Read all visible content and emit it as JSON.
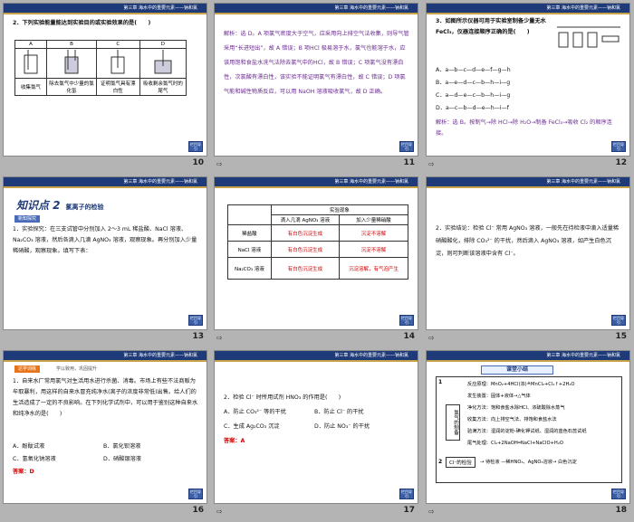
{
  "header_text": "第三章 海水中的重要元素——钠和氯",
  "nav_label": "栏目导引",
  "foot_icon": "⇨",
  "slides": [
    {
      "num": "10",
      "q": "2．下列实验能量能达到实验目的或实验效果的是(　　)",
      "cols": [
        "A",
        "B",
        "C",
        "D"
      ],
      "labels": [
        "收集氯气",
        "除去氯气中少量的氯化氢",
        "证明氯气具有漂白性",
        "吸收剩余氯气时的尾气"
      ]
    },
    {
      "num": "11",
      "text": "解析：选 D。A 项氯气密度大于空气，应采用向上排空气法收集，则导气管采用“长进短出”，故 A 错误；B 项HCl 极易溶于水，氯气也能溶于水，应该用饱和食盐水洗气法除去氯气中的HCl，故 B 错误；C 项氯气没有漂白性，次氯酸有漂白性，该实验不能证明氯气有漂白性，故 C 错误；D 项氯气能和碱性物质反应，可以用 NaOH 溶液吸收氯气，故 D 正确。"
    },
    {
      "num": "12",
      "q": "3．如图所示仪器可用于实验室制备少量无水 FeCl₃，仪器连接顺序正确的是(　　)",
      "opts": [
        "A．a—b—c—d—e—f—g—h",
        "B．a—e—d—c—b—h—i—g",
        "C．a—d—e—c—b—h—i—g",
        "D．a—c—b—d—e—h—i—f"
      ],
      "ans": "解析：选 B。按制气→除 HCl→除 H₂O→制备 FeCl₃→吸收 Cl₂ 的顺序连接。"
    },
    {
      "num": "13",
      "kp_title": "知识点 2",
      "kp_sub": "氯离子的检验",
      "tag": "新知探究",
      "text": "1．实验探究：在三支试管中分别加入 2～3 mL 稀盐酸、NaCl 溶液、Na₂CO₃ 溶液，然后各滴入几滴 AgNO₃ 溶液，观察现象。再分别加入少量稀硝酸，观察现象。填写下表："
    },
    {
      "num": "14",
      "th": [
        "",
        "实验现象"
      ],
      "sub": [
        "滴入几滴 AgNO₃ 溶液",
        "加入少量稀硝酸"
      ],
      "rows": [
        [
          "稀盐酸",
          "有白色沉淀生成",
          "沉淀不溶解"
        ],
        [
          "NaCl 溶液",
          "有白色沉淀生成",
          "沉淀不溶解"
        ],
        [
          "Na₂CO₃ 溶液",
          "有白色沉淀生成",
          "沉淀溶解，有气泡产生"
        ]
      ]
    },
    {
      "num": "15",
      "text": "2．实验结论：检验 Cl⁻ 常用 AgNO₃ 溶液，一般先在待检液中滴入适量稀硝酸酸化，排除 CO₃²⁻ 的干扰，然后滴入 AgNO₃ 溶液，如产生白色沉淀，则可判断该溶液中含有 Cl⁻。"
    },
    {
      "num": "16",
      "tag": "达学训练",
      "tag2": "学以致用，巩固提升",
      "q": "1．自来水厂常用氯气对生活用水进行杀菌、消毒。市场上有些不法商贩为牟取暴利，用这样的自来水冒充纯净水(离子的浓度非常低)出售。给人们的生活造成了一定的不良影响。在下列化学试剂中，可以用于鉴别这种自来水和纯净水的是(　　)",
      "opts": [
        "A．酚酞试液",
        "B．氯化钡溶液",
        "C．氢氧化钠溶液",
        "D．硝酸银溶液"
      ],
      "ans": "答案：D"
    },
    {
      "num": "17",
      "q": "2．检验 Cl⁻ 时所用试剂 HNO₃ 的作用是(　　)",
      "opts": [
        "A．防止 CO₃²⁻ 等的干扰",
        "B．防止 Cl⁻ 的干扰",
        "C．生成 Ag₂CO₃ 沉淀",
        "D．防止 NO₃⁻ 的干扰"
      ],
      "ans": "答案：A"
    },
    {
      "num": "18",
      "title": "课堂小结",
      "lines": [
        "反应原理：MnO₂+4HCl(浓)≜MnCl₂+Cl₂↑+2H₂O",
        "发生装置：固体+液体→△气体",
        "净化方法：饱和食盐水除HCl、浓硫酸除水蒸气",
        "收集方法：向上排空气法、排饱和食盐水法",
        "验满方法：湿润的淀粉-碘化钾试纸、湿润的蓝色石蕊试纸",
        "尾气处理：Cl₂+2NaOH═NaCl+NaClO+H₂O"
      ],
      "side": "氯气的制备",
      "n1": "1",
      "n2": "2",
      "cl": "Cl⁻的检验",
      "cl_detail": "→ 待检液 —稀HNO₃、AgNO₃溶液→ 白色沉淀"
    }
  ]
}
